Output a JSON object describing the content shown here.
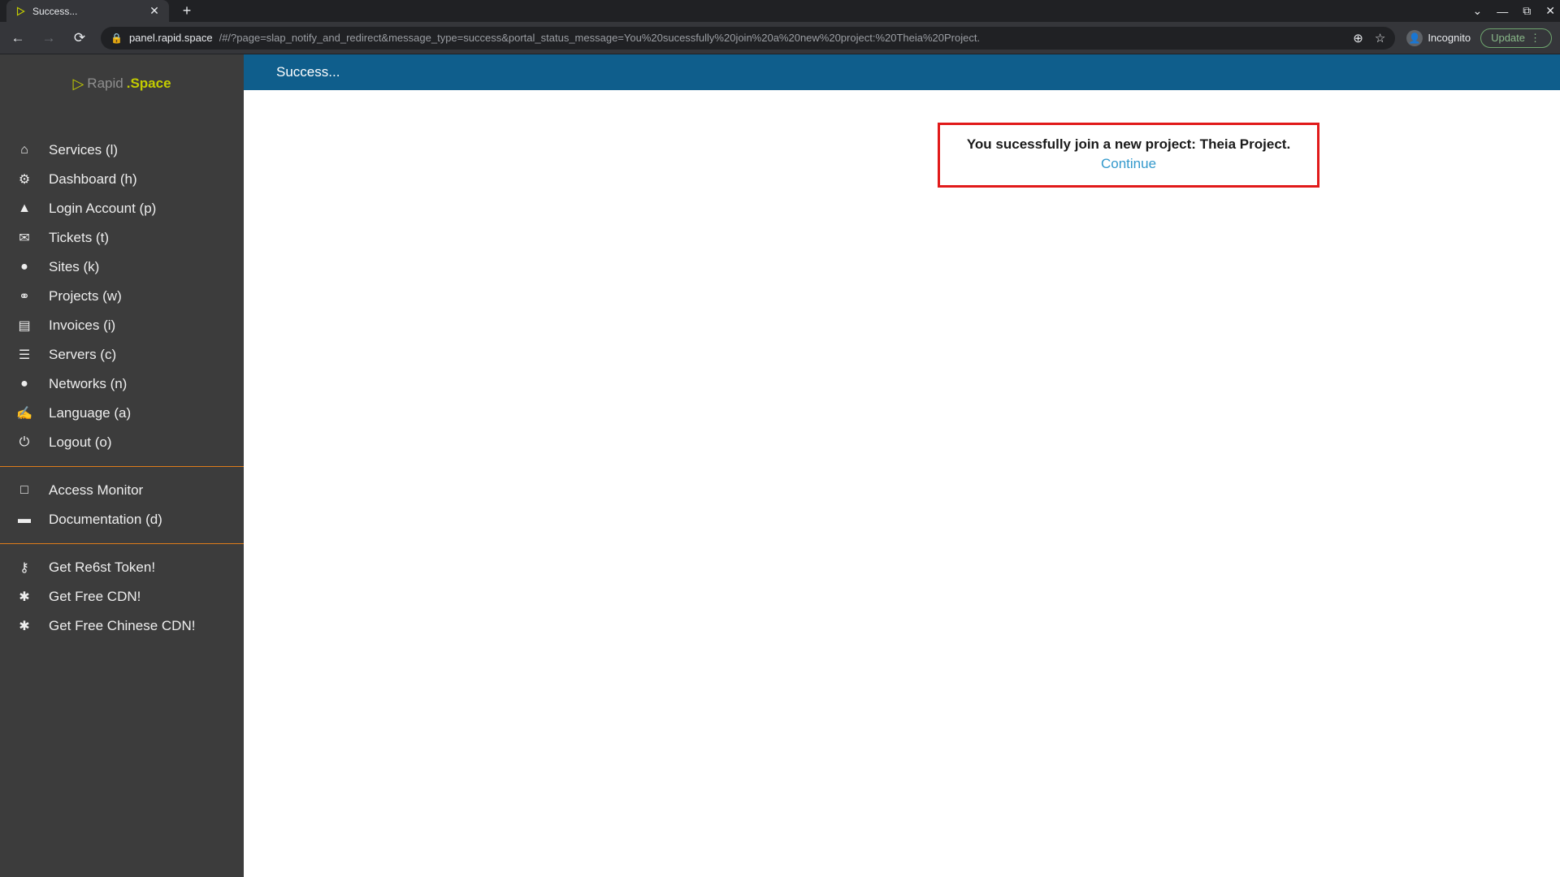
{
  "browser": {
    "tab_title": "Success...",
    "url_host": "panel.rapid.space",
    "url_rest": "/#/?page=slap_notify_and_redirect&message_type=success&portal_status_message=You%20sucessfully%20join%20a%20new%20project:%20Theia%20Project.",
    "incognito_label": "Incognito",
    "update_label": "Update"
  },
  "logo": {
    "text1": "Rapid",
    "text2": ".Space"
  },
  "sidebar": {
    "section1": [
      {
        "icon": "home-icon",
        "glyph": "⌂",
        "label": "Services (l)"
      },
      {
        "icon": "sliders-icon",
        "glyph": "⚙",
        "label": "Dashboard (h)"
      },
      {
        "icon": "user-icon",
        "glyph": "▲",
        "label": "Login Account (p)"
      },
      {
        "icon": "comments-icon",
        "glyph": "✉",
        "label": "Tickets (t)"
      },
      {
        "icon": "map-marker-icon",
        "glyph": "●",
        "label": "Sites (k)"
      },
      {
        "icon": "share-icon",
        "glyph": "⚭",
        "label": "Projects (w)"
      },
      {
        "icon": "credit-card-icon",
        "glyph": "▤",
        "label": "Invoices (i)"
      },
      {
        "icon": "database-icon",
        "glyph": "☰",
        "label": "Servers (c)"
      },
      {
        "icon": "globe-icon",
        "glyph": "●",
        "label": "Networks (n)"
      },
      {
        "icon": "language-icon",
        "glyph": "✍",
        "label": "Language (a)"
      },
      {
        "icon": "power-icon",
        "glyph": "⏻",
        "label": "Logout (o)"
      }
    ],
    "section2": [
      {
        "icon": "monitor-icon",
        "glyph": "□",
        "label": "Access Monitor"
      },
      {
        "icon": "book-icon",
        "glyph": "▬",
        "label": "Documentation (d)"
      }
    ],
    "section3": [
      {
        "icon": "key-icon",
        "glyph": "⚷",
        "label": "Get Re6st Token!"
      },
      {
        "icon": "asterisk-icon",
        "glyph": "✱",
        "label": "Get Free CDN!"
      },
      {
        "icon": "asterisk-icon",
        "glyph": "✱",
        "label": "Get Free Chinese CDN!"
      }
    ]
  },
  "topbar": {
    "title": "Success..."
  },
  "notice": {
    "message": "You sucessfully join a new project: Theia Project.",
    "continue": "Continue"
  }
}
